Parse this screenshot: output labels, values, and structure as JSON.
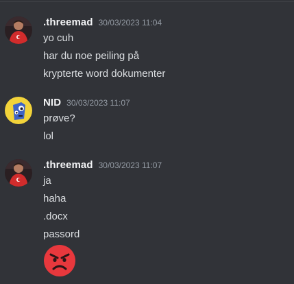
{
  "groups": [
    {
      "username": ".threemad",
      "timestamp": "30/03/2023 11:04",
      "messages": [
        "yo cuh",
        "har du noe peiling på",
        "krypterte word dokumenter"
      ]
    },
    {
      "username": "NID",
      "timestamp": "30/03/2023 11:07",
      "messages": [
        "prøve?",
        "lol"
      ]
    },
    {
      "username": ".threemad",
      "timestamp": "30/03/2023 11:07",
      "messages": [
        "ja",
        "haha",
        ".docx",
        "passord"
      ]
    }
  ],
  "emoji": "angry-face-emoji",
  "colors": {
    "background": "#313338",
    "username": "#f2f3f5",
    "timestamp": "#949ba4",
    "text": "#dbdee1",
    "emoji_red": "#e8383d"
  }
}
